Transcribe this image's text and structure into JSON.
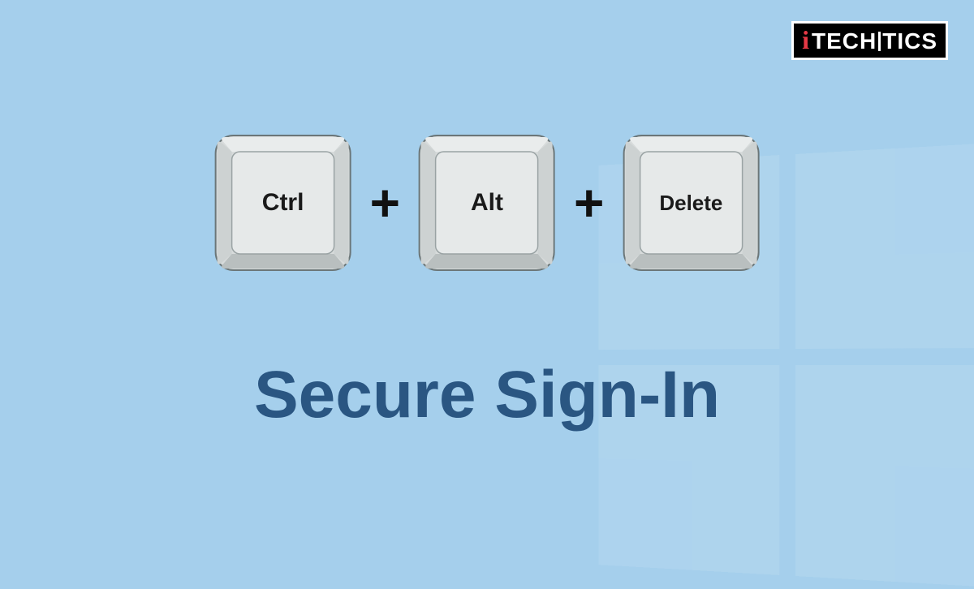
{
  "brand": {
    "prefix": "i",
    "part1": "TECH",
    "part2": "TICS"
  },
  "keys": {
    "key1": "Ctrl",
    "key2": "Alt",
    "key3": "Delete",
    "separator": "+"
  },
  "title": "Secure Sign-In"
}
